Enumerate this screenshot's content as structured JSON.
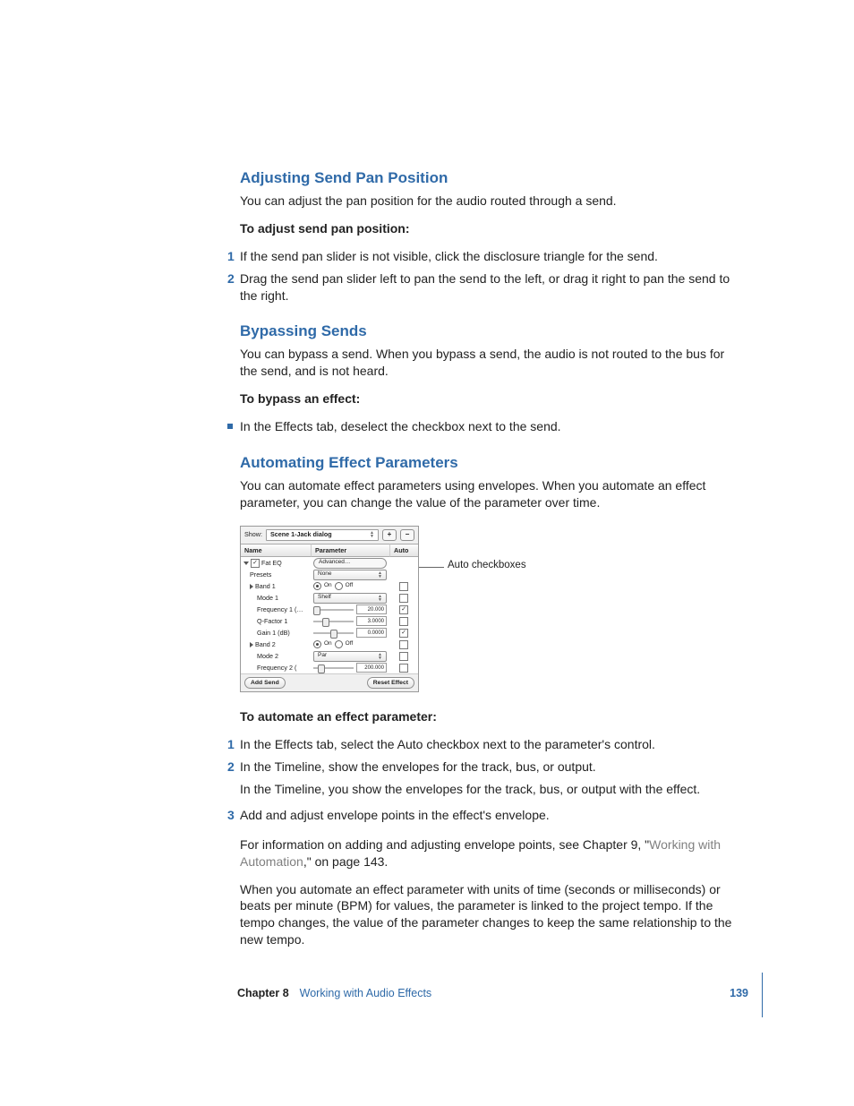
{
  "sections": {
    "s1": {
      "heading": "Adjusting Send Pan Position",
      "intro": "You can adjust the pan position for the audio routed through a send.",
      "taskTitle": "To adjust send pan position:",
      "steps": [
        "If the send pan slider is not visible, click the disclosure triangle for the send.",
        "Drag the send pan slider left to pan the send to the left, or drag it right to pan the send to the right."
      ]
    },
    "s2": {
      "heading": "Bypassing Sends",
      "intro": "You can bypass a send. When you bypass a send, the audio is not routed to the bus for the send, and is not heard.",
      "taskTitle": "To bypass an effect:",
      "bullet": "In the Effects tab, deselect the checkbox next to the send."
    },
    "s3": {
      "heading": "Automating Effect Parameters",
      "intro": "You can automate effect parameters using envelopes. When you automate an effect parameter, you can change the value of the parameter over time.",
      "taskTitle": "To automate an effect parameter:",
      "steps": [
        "In the Effects tab, select the Auto checkbox next to the parameter's control.",
        "In the Timeline, show the envelopes for the track, bus, or output.",
        "Add and adjust envelope points in the effect's envelope."
      ],
      "step2sub": "In the Timeline, you show the envelopes for the track, bus, or output with the effect.",
      "xref_pre": "For information on adding and adjusting envelope points, see Chapter 9, \"",
      "xref_link": "Working with Automation",
      "xref_post": ",\" on page 143.",
      "tail": "When you automate an effect parameter with units of time (seconds or milliseconds) or beats per minute (BPM) for values, the parameter is linked to the project tempo. If the tempo changes, the value of the parameter changes to keep the same relationship to the new tempo."
    }
  },
  "panel": {
    "showLabel": "Show:",
    "showValue": "Scene 1-Jack dialog",
    "plus": "+",
    "minus": "−",
    "headers": {
      "name": "Name",
      "parameter": "Parameter",
      "auto": "Auto"
    },
    "rows": {
      "r0": {
        "name": "Fat EQ",
        "param": "Advanced…"
      },
      "r1": {
        "name": "Presets",
        "param": "None"
      },
      "r2": {
        "name": "Band 1",
        "onLabel": "On",
        "offLabel": "Off"
      },
      "r3": {
        "name": "Mode 1",
        "param": "Shelf"
      },
      "r4": {
        "name": "Frequency 1 (…",
        "value": "20.000"
      },
      "r5": {
        "name": "Q-Factor 1",
        "value": "3.0000"
      },
      "r6": {
        "name": "Gain 1 (dB)",
        "value": "0.0000"
      },
      "r7": {
        "name": "Band 2",
        "onLabel": "On",
        "offLabel": "Off"
      },
      "r8": {
        "name": "Mode 2",
        "param": "Par"
      },
      "r9": {
        "name": "Frequency 2 (",
        "value": "200.000"
      }
    },
    "addSend": "Add Send",
    "resetEffect": "Reset Effect",
    "callout": "Auto checkboxes"
  },
  "footer": {
    "chapter": "Chapter 8",
    "title": "Working with Audio Effects",
    "pageNumber": "139"
  }
}
